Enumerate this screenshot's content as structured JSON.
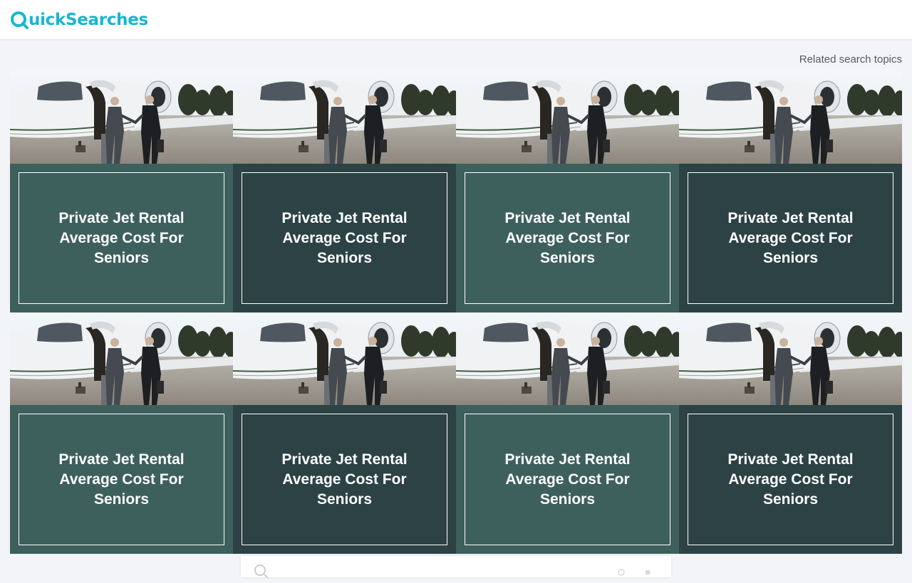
{
  "header": {
    "logo_text": "uickSearches",
    "brand_color": "#17b6d1"
  },
  "related_label": "Related search topics",
  "cards": [
    {
      "title": "Private Jet Rental Average Cost For Seniors",
      "panel_color": "#3d605c"
    },
    {
      "title": "Private Jet Rental Average Cost For Seniors",
      "panel_color": "#2c4245"
    },
    {
      "title": "Private Jet Rental Average Cost For Seniors",
      "panel_color": "#3d605c"
    },
    {
      "title": "Private Jet Rental Average Cost For Seniors",
      "panel_color": "#2c4245"
    },
    {
      "title": "Private Jet Rental Average Cost For Seniors",
      "panel_color": "#3d605c"
    },
    {
      "title": "Private Jet Rental Average Cost For Seniors",
      "panel_color": "#2c4245"
    },
    {
      "title": "Private Jet Rental Average Cost For Seniors",
      "panel_color": "#3d605c"
    },
    {
      "title": "Private Jet Rental Average Cost For Seniors",
      "panel_color": "#2c4245"
    }
  ],
  "icons": {
    "logo": "magnifier-q-icon",
    "search": "search-icon"
  }
}
